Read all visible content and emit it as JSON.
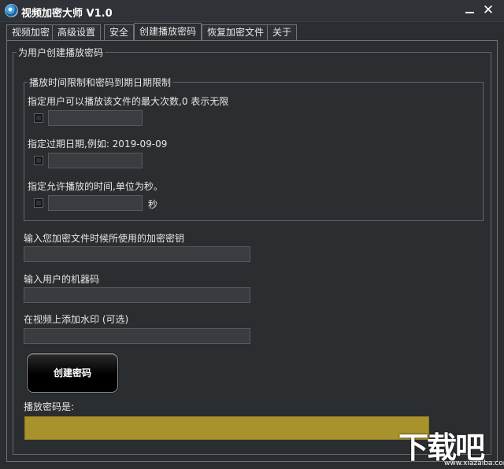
{
  "window": {
    "title": "视频加密大师 V1.0",
    "minimize_icon": "minimize-icon",
    "close_label": "✕"
  },
  "tabs": [
    {
      "label": "视频加密",
      "active": false
    },
    {
      "label": "高级设置",
      "active": false
    },
    {
      "label": "安全",
      "active": false
    },
    {
      "label": "创建播放密码",
      "active": true
    },
    {
      "label": "恢复加密文件",
      "active": false
    },
    {
      "label": "关于",
      "active": false
    }
  ],
  "create_password": {
    "group_title": "为用户创建播放密码",
    "limits": {
      "group_title": "播放时间限制和密码到期日期限制",
      "max_plays_label": "指定用户可以播放该文件的最大次数,0 表示无限",
      "max_plays_value": "",
      "expiry_label": "指定过期日期,例如: 2019-09-09",
      "expiry_value": "",
      "duration_label": "指定允许播放的时间,单位为秒。",
      "duration_value": "",
      "duration_unit": "秒"
    },
    "encryption_key_label": "输入您加密文件时候所使用的加密密钥",
    "encryption_key_value": "",
    "machine_code_label": "输入用户的机器码",
    "machine_code_value": "",
    "watermark_label": "在视频上添加水印 (可选)",
    "watermark_value": "",
    "create_button_label": "创建密码",
    "result_label": "播放密码是:",
    "result_value": "",
    "result_color": "#a9922c"
  },
  "site_watermark": {
    "logo_text": "下载吧",
    "url_text": "www.xiazaiba.com"
  }
}
